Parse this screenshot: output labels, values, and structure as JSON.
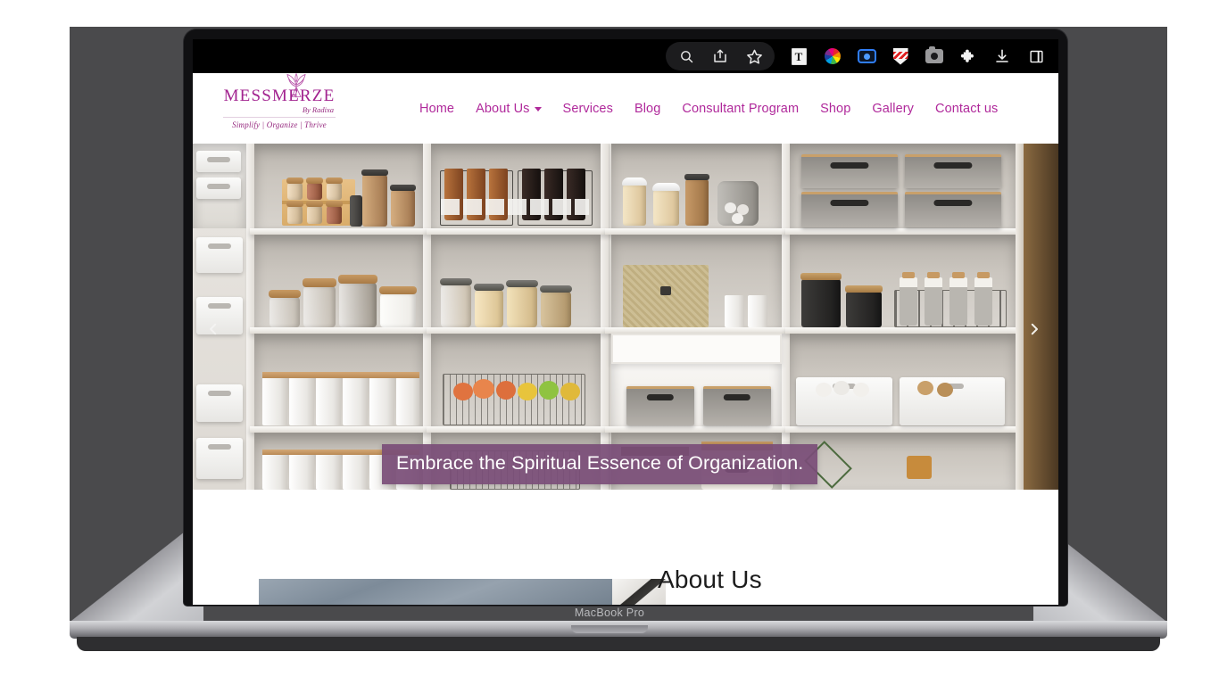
{
  "device": {
    "model_label": "MacBook Pro"
  },
  "browser": {
    "toolbar": {
      "pill_icons": [
        {
          "name": "search-icon",
          "label": "Search"
        },
        {
          "name": "share-icon",
          "label": "Share"
        },
        {
          "name": "bookmark-star-icon",
          "label": "Add bookmark"
        }
      ],
      "extension_icons": [
        {
          "name": "text-document-extension-icon",
          "glyph": "T",
          "label": "Text tool"
        },
        {
          "name": "color-picker-extension-icon",
          "label": "Color picker"
        },
        {
          "name": "screen-capture-extension-icon",
          "label": "Screen capture"
        },
        {
          "name": "shield-extension-icon",
          "label": "Privacy shield"
        },
        {
          "name": "camera-extension-icon",
          "label": "Screenshot camera"
        },
        {
          "name": "puzzle-extensions-icon",
          "label": "Extensions"
        },
        {
          "name": "downloads-icon",
          "label": "Downloads"
        },
        {
          "name": "side-panel-icon",
          "label": "Side panel"
        }
      ]
    }
  },
  "site": {
    "logo": {
      "wordmark_left": "MESSMER",
      "wordmark_right": "ZE",
      "byline": "By Radixa",
      "tagline": "Simplify | Organize | Thrive",
      "flower_icon": "flower-ornament-icon"
    },
    "nav": [
      {
        "label": "Home",
        "has_dropdown": false
      },
      {
        "label": "About Us",
        "has_dropdown": true
      },
      {
        "label": "Services",
        "has_dropdown": false
      },
      {
        "label": "Blog",
        "has_dropdown": false
      },
      {
        "label": "Consultant Program",
        "has_dropdown": false
      },
      {
        "label": "Shop",
        "has_dropdown": false
      },
      {
        "label": "Gallery",
        "has_dropdown": false
      },
      {
        "label": "Contact us",
        "has_dropdown": false
      }
    ],
    "hero": {
      "caption": "Embrace the Spiritual Essence of Organization.",
      "prev_arrow": "chevron-left-icon",
      "next_arrow": "chevron-right-icon",
      "image_alt": "Organized white pantry shelving with glass jars, bottles, baskets and bins"
    },
    "about": {
      "title": "About Us"
    },
    "colors": {
      "brand_magenta": "#b0299b",
      "logo_purple": "#a2238f",
      "caption_bg": "#7a4d77",
      "toolbar_bg": "#000000",
      "page_bg": "#ffffff"
    }
  }
}
